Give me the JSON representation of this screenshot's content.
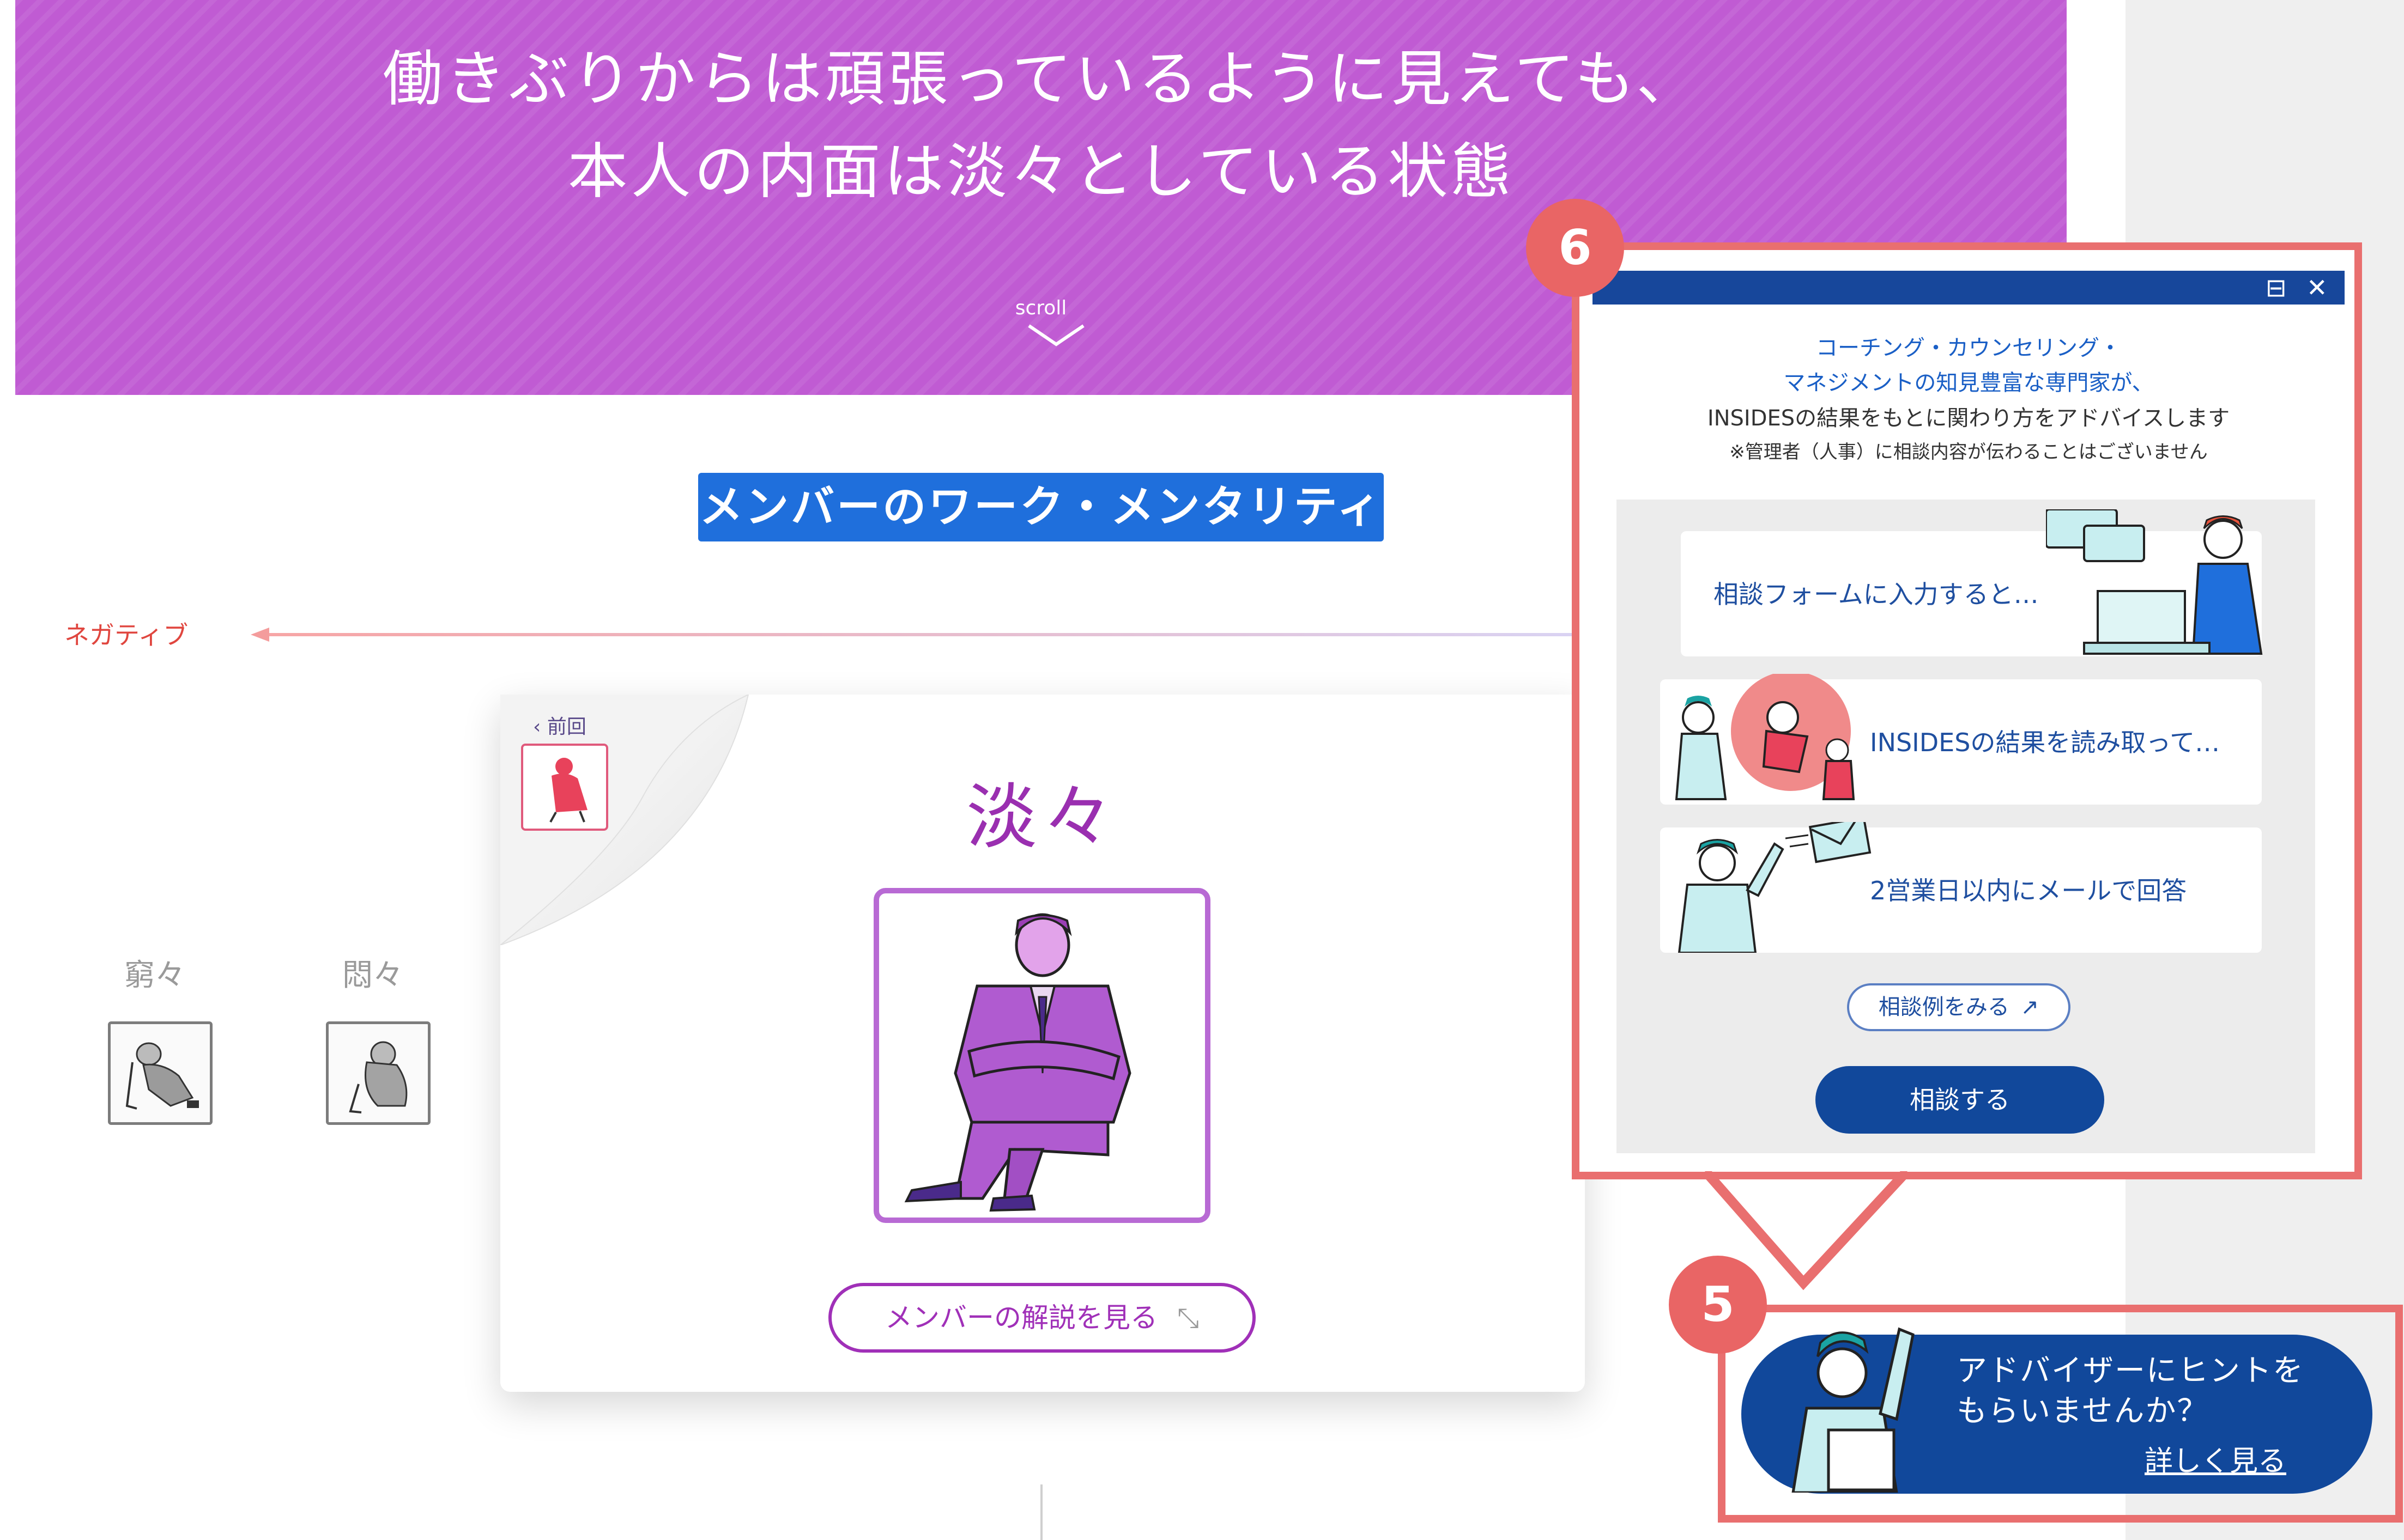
{
  "hero": {
    "line1": "働きぶりからは頑張っているように見えても、",
    "line2": "本人の内面は淡々としている状態",
    "scroll": "scroll"
  },
  "section": {
    "title": "メンバーのワーク・メンタリティ"
  },
  "axis": {
    "negative_label": "ネガティブ"
  },
  "mini_cards": [
    {
      "label": "窮々"
    },
    {
      "label": "悶々"
    }
  ],
  "card": {
    "prev_label": "前回",
    "title": "淡々",
    "explain_button": "メンバーの解説を見る"
  },
  "popup": {
    "badge": "6",
    "intro_line1": "コーチング・カウンセリング・",
    "intro_line2": "マネジメントの知見豊富な専門家が、",
    "intro_line3": "INSIDESの結果をもとに関わり方をアドバイスします",
    "note": "※管理者（人事）に相談内容が伝わることはございません",
    "steps": [
      {
        "label": "相談フォームに入力すると…"
      },
      {
        "label": "INSIDESの結果を読み取って…"
      },
      {
        "label": "2営業日以内にメールで回答"
      }
    ],
    "example_button": "相談例をみる",
    "consult_button": "相談する"
  },
  "banner": {
    "badge": "5",
    "line1": "アドバイザーにヒントを",
    "line2": "もらいませんか？",
    "link": "詳しく見る"
  },
  "colors": {
    "hero_purple": "#c05bd3",
    "section_blue": "#1f6fdc",
    "negative_red": "#e0463f",
    "card_purple": "#9a2fb0",
    "advisor_navy": "#11489b",
    "highlight_red": "#e96f6f"
  }
}
